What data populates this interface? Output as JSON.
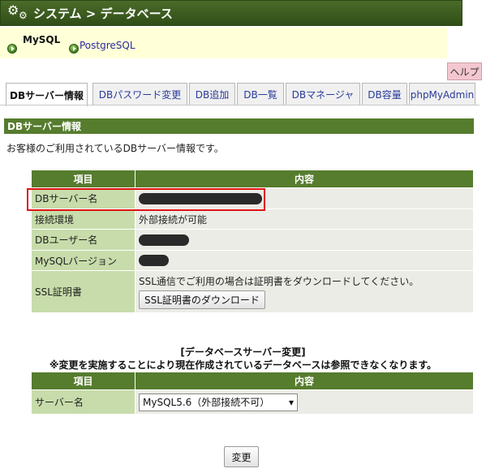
{
  "title_bar": {
    "title": "システム > データベース",
    "icon": "gears-icon"
  },
  "db_switch": {
    "items": [
      {
        "label": "MySQL",
        "active": true
      },
      {
        "label": "PostgreSQL",
        "active": false
      }
    ]
  },
  "help": {
    "label": "ヘルプ"
  },
  "tabs": [
    {
      "label": "DBサーバー情報",
      "active": true
    },
    {
      "label": "DBパスワード変更"
    },
    {
      "label": "DB追加"
    },
    {
      "label": "DB一覧"
    },
    {
      "label": "DBマネージャ"
    },
    {
      "label": "DB容量"
    },
    {
      "label": "phpMyAdmin"
    }
  ],
  "section": {
    "header": "DBサーバー情報",
    "description": "お客様のご利用されているDBサーバー情報です。"
  },
  "info_table": {
    "headers": [
      "項目",
      "内容"
    ],
    "rows": [
      {
        "key": "DBサーバー名",
        "value": ""
      },
      {
        "key": "接続環境",
        "value": "外部接続が可能"
      },
      {
        "key": "DBユーザー名",
        "value": ""
      },
      {
        "key": "MySQLバージョン",
        "value": ""
      },
      {
        "key": "SSL証明書",
        "value": "SSL通信でご利用の場合は証明書をダウンロードしてください。"
      }
    ],
    "download_button": "SSL証明書のダウンロード"
  },
  "change": {
    "title": "[データベースサーバー変更]",
    "warning": "※変更を実施することにより現在作成されているデータベースは参照できなくなります。",
    "headers": [
      "項目",
      "内容"
    ],
    "row_key": "サーバー名",
    "selected_value": "MySQL5.6（外部接続不可）",
    "submit": "変更"
  },
  "colors": {
    "header_green": "#567c2e",
    "key_cell": "#c7dcaa",
    "value_cell": "#ecece6",
    "highlight": "#e01212",
    "help_bg": "#f4c7d0"
  }
}
